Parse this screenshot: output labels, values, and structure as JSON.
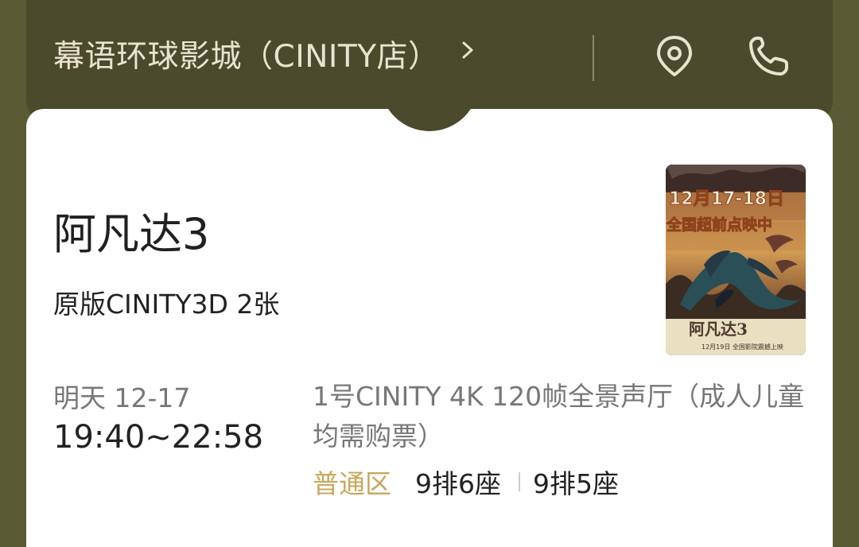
{
  "header": {
    "cinema_name": "幕语环球影城（CINITY店）",
    "chevron_icon": "chevron-right-icon",
    "location_icon": "location-pin-icon",
    "phone_icon": "phone-icon"
  },
  "movie": {
    "title": "阿凡达3",
    "format": "原版CINITY3D 2张",
    "poster": {
      "headline": "12月17-18日",
      "subline": "全国超前点映中",
      "title": "阿凡达3",
      "footer": "12月19日 全国影院震撼上映"
    }
  },
  "showtime": {
    "date": "明天 12-17",
    "time": "19:40~22:58",
    "hall": "1号CINITY 4K 120帧全景声厅（成人儿童均需购票）",
    "area": "普通区",
    "seats": [
      "9排6座",
      "9排5座"
    ]
  },
  "colors": {
    "background": "#5a5a35",
    "header": "#4b4a2c",
    "accent": "#c8a75d"
  }
}
